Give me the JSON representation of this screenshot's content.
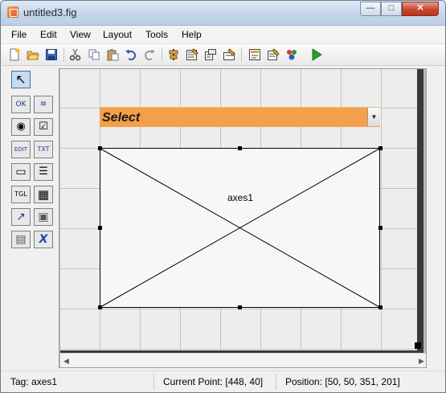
{
  "window": {
    "title": "untitled3.fig"
  },
  "caption_buttons": {
    "minimize": "—",
    "maximize": "□",
    "close": "✕"
  },
  "menubar": {
    "items": [
      "File",
      "Edit",
      "View",
      "Layout",
      "Tools",
      "Help"
    ]
  },
  "toolbar": {
    "icons": [
      "new-file-icon",
      "open-folder-icon",
      "save-icon",
      "cut-icon",
      "copy-icon",
      "paste-icon",
      "undo-icon",
      "redo-icon",
      "align-objects-icon",
      "menu-editor-icon",
      "tab-order-editor-icon",
      "toolbar-editor-icon",
      "editor-icon",
      "property-inspector-icon",
      "object-browser-icon",
      "run-figure-icon"
    ]
  },
  "palette": {
    "tools": [
      {
        "name": "select-tool",
        "glyph": "↖"
      },
      {
        "name": "push-button-tool",
        "glyph": "OK"
      },
      {
        "name": "slider-tool",
        "glyph": "≡"
      },
      {
        "name": "radio-button-tool",
        "glyph": "◉"
      },
      {
        "name": "check-box-tool",
        "glyph": "☑"
      },
      {
        "name": "edit-text-tool",
        "glyph": "EDIT"
      },
      {
        "name": "static-text-tool",
        "glyph": "TXT"
      },
      {
        "name": "pop-up-menu-tool",
        "glyph": "▭"
      },
      {
        "name": "listbox-tool",
        "glyph": "☰"
      },
      {
        "name": "toggle-button-tool",
        "glyph": "TGL"
      },
      {
        "name": "table-tool",
        "glyph": "▦"
      },
      {
        "name": "axes-tool",
        "glyph": "↗"
      },
      {
        "name": "panel-tool",
        "glyph": "▣"
      },
      {
        "name": "button-group-tool",
        "glyph": "▤"
      },
      {
        "name": "activex-control-tool",
        "glyph": "X"
      }
    ]
  },
  "canvas": {
    "popup_menu": {
      "label": "Select"
    },
    "axes": {
      "label": "axes1"
    },
    "colors": {
      "popup_background": "#f4a04b",
      "axes_background": "#f7f7f7"
    }
  },
  "statusbar": {
    "tag": "Tag: axes1",
    "current_point": "Current Point:  [448, 40]",
    "position": "Position: [50, 50, 351, 201]"
  }
}
